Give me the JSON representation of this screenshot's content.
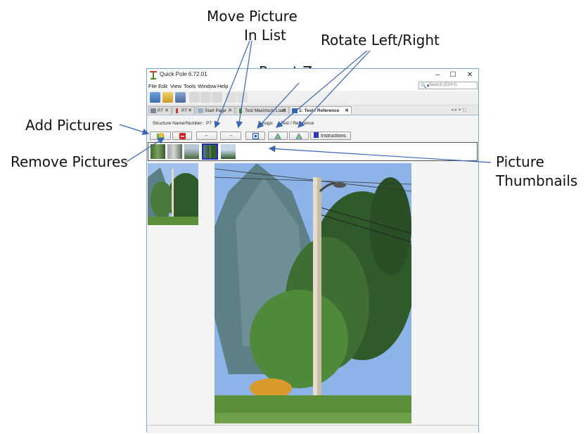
{
  "callouts": {
    "move_picture": "Move Picture\nIn List",
    "rotate": "Rotate Left/Right",
    "reset_zoom": "Reset Zoom",
    "add_pictures": "Add Pictures",
    "remove_pictures": "Remove Pictures",
    "picture_thumbnails": "Picture\nThumbnails"
  },
  "window": {
    "title": "Quick Pole 6.72.01",
    "controls": {
      "minimize": "–",
      "maximize": "☐",
      "close": "✕"
    }
  },
  "menu": [
    "File",
    "Edit",
    "View",
    "Tools",
    "Window",
    "Help"
  ],
  "search": {
    "placeholder": "Search (Ctrl+I)"
  },
  "tabs": [
    {
      "label": "P7",
      "close": "✕"
    },
    {
      "label": "P7",
      "close": "✕"
    },
    {
      "label": "Start Page",
      "close": "✕"
    },
    {
      "label": "Test Maximum Load",
      "close": "✕"
    },
    {
      "label": "1: Test / Reference",
      "close": "✕"
    }
  ],
  "tab_nav": "◂ ▸ ▾ ◻",
  "form": {
    "structure_label": "Structure Name/Number:",
    "structure_value": "P7",
    "design_label": "Design:",
    "design_value": "Test / Reference"
  },
  "buttons": {
    "move_left": "←",
    "move_right": "→",
    "instructions": "Instructions"
  },
  "thumbnails": [
    {
      "selected": false
    },
    {
      "selected": false
    },
    {
      "selected": false
    },
    {
      "selected": true
    },
    {
      "selected": false
    }
  ],
  "colors": {
    "sky": "#8db4e8",
    "tree_dark": "#2f5a2a",
    "tree_light": "#4f8a3a",
    "spruce": "#5d7f86",
    "grass": "#5b8f3a",
    "selection": "#1a2fb5",
    "arrow": "#3a64b5"
  }
}
